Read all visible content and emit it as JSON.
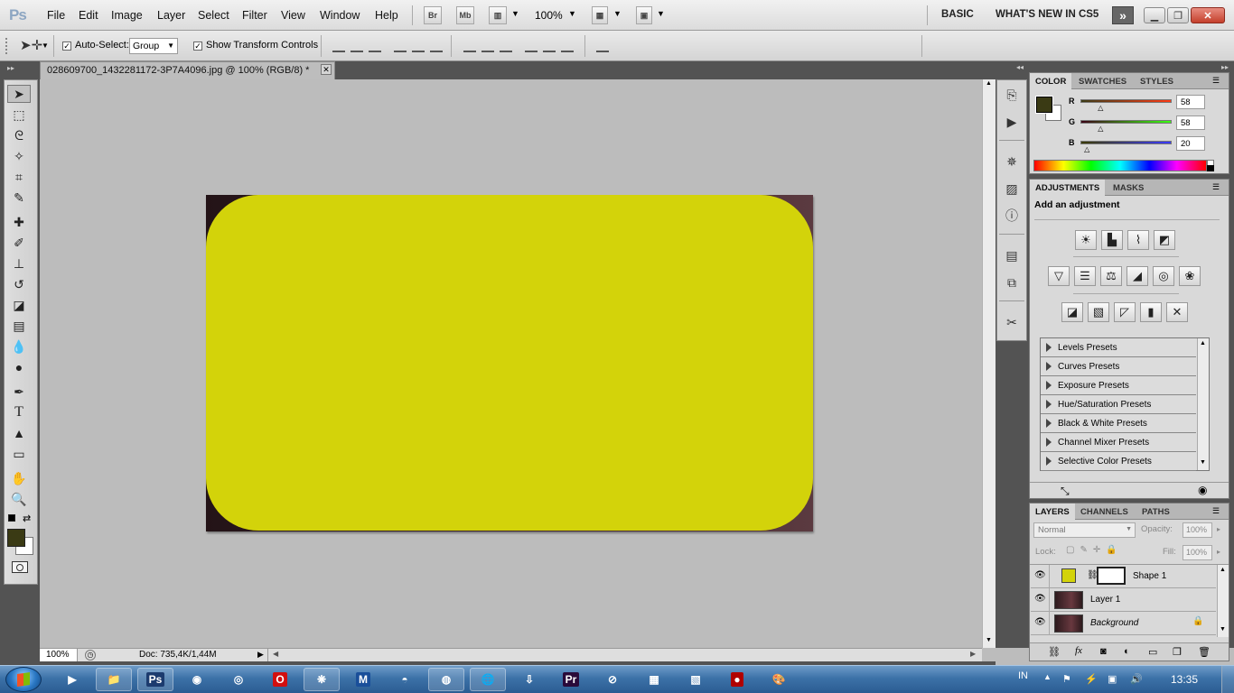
{
  "menubar": {
    "app_logo": "Ps",
    "items": [
      "File",
      "Edit",
      "Image",
      "Layer",
      "Select",
      "Filter",
      "View",
      "Window",
      "Help"
    ],
    "bridge": "Br",
    "mini_bridge": "Mb",
    "zoom": "100%",
    "workspace_basic": "BASIC",
    "workspace_new": "WHAT'S NEW IN CS5",
    "more": "»"
  },
  "options": {
    "auto_select_label": "Auto-Select:",
    "auto_select_checked": true,
    "auto_select_value": "Group",
    "show_transform_label": "Show Transform Controls",
    "show_transform_checked": true
  },
  "document": {
    "tab_title": "028609700_1432281172-3P7A4096.jpg @ 100% (RGB/8) *",
    "shape_color": "#d3d30a",
    "zoom": "100%",
    "doc_info": "Doc: 735,4K/1,44M"
  },
  "tools": {
    "foreground": "#3a3a14",
    "background": "#ffffff",
    "icons": [
      "move-icon",
      "marquee-icon",
      "lasso-icon",
      "magic-wand-icon",
      "crop-icon",
      "eyedropper-icon",
      "healing-brush-icon",
      "brush-icon",
      "clone-stamp-icon",
      "history-brush-icon",
      "eraser-icon",
      "gradient-icon",
      "blur-icon",
      "dodge-icon",
      "pen-icon",
      "type-icon",
      "path-selection-icon",
      "shape-icon",
      "hand-icon",
      "zoom-icon"
    ]
  },
  "color_panel": {
    "tabs": [
      "COLOR",
      "SWATCHES",
      "STYLES"
    ],
    "r_label": "R",
    "g_label": "G",
    "b_label": "B",
    "r": "58",
    "g": "58",
    "b": "20",
    "r_fraction": 0.23,
    "g_fraction": 0.23,
    "b_fraction": 0.08
  },
  "adjustments": {
    "tabs": [
      "ADJUSTMENTS",
      "MASKS"
    ],
    "title": "Add an adjustment",
    "presets": [
      "Levels Presets",
      "Curves Presets",
      "Exposure Presets",
      "Hue/Saturation Presets",
      "Black & White Presets",
      "Channel Mixer Presets",
      "Selective Color Presets"
    ]
  },
  "layers_panel": {
    "tabs": [
      "LAYERS",
      "CHANNELS",
      "PATHS"
    ],
    "blend_mode": "Normal",
    "opacity_label": "Opacity:",
    "opacity": "100%",
    "lock_label": "Lock:",
    "fill_label": "Fill:",
    "fill": "100%",
    "layers": [
      {
        "name": "Shape 1"
      },
      {
        "name": "Layer 1"
      },
      {
        "name": "Background"
      }
    ]
  },
  "taskbar": {
    "language": "IN",
    "time": "13:35",
    "apps": [
      "media-player-icon",
      "explorer-icon",
      "photoshop-icon",
      "firefox-icon",
      "chrome-icon",
      "opera-icon",
      "app-icon",
      "mail-icon",
      "app2-icon",
      "app3-icon",
      "network-icon",
      "app4-icon",
      "premiere-icon",
      "app5-icon",
      "app6-icon",
      "app7-icon",
      "record-icon",
      "paint-icon"
    ]
  }
}
